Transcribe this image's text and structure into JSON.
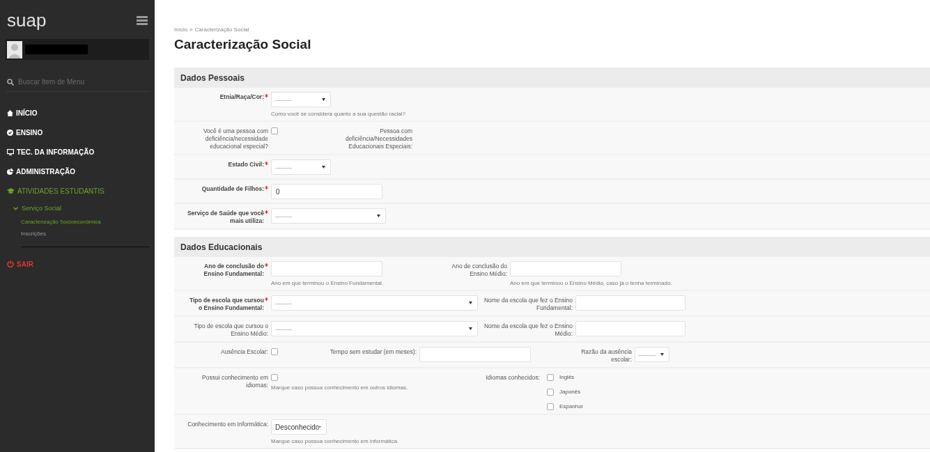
{
  "sidebar": {
    "logo": "suap",
    "search": {
      "placeholder": "Buscar Item de Menu"
    },
    "menu": [
      {
        "label": "INÍCIO",
        "selected": false
      },
      {
        "label": "ENSINO",
        "selected": false
      },
      {
        "label": "TEC. DA INFORMAÇÃO",
        "selected": false
      },
      {
        "label": "ADMINISTRAÇÃO",
        "selected": false
      },
      {
        "label": "ATIVIDADES ESTUDANTIS",
        "selected": true,
        "children": [
          {
            "label": "Serviço Social",
            "selected": true,
            "expanded": true,
            "children": [
              {
                "label": "Caracterização Socioeconômica",
                "selected": true
              },
              {
                "label": "Inscrições",
                "selected": false
              }
            ]
          }
        ]
      }
    ],
    "logout": {
      "label": "SAIR"
    }
  },
  "breadcrumb": {
    "items": [
      "Início",
      "Caracterização Social"
    ],
    "separator": "»"
  },
  "title": "Caracterização Social",
  "sections": [
    {
      "title": "Dados Pessoais",
      "rows": [
        {
          "fields": [
            {
              "kind": "select",
              "label": "Etnia/Raça/Cor:",
              "required": true,
              "value": "---------",
              "help": "Como você se considera quanto a sua questão racial?"
            }
          ]
        },
        {
          "fields": [
            {
              "kind": "checkbox",
              "label": "Você é uma pessoa com deficiência/necessidade educacional especial?",
              "required": false,
              "checked": false
            },
            {
              "kind": "label",
              "label": "Pessoa com deficiência/Necessidades Educacionais Especiais:",
              "required": false
            }
          ]
        },
        {
          "fields": [
            {
              "kind": "select",
              "label": "Estado Civil:",
              "required": true,
              "value": "---------"
            }
          ]
        },
        {
          "fields": [
            {
              "kind": "text",
              "label": "Quantidade de Filhos:",
              "required": true,
              "value": "0"
            }
          ]
        },
        {
          "fields": [
            {
              "kind": "select",
              "label": "Serviço de Saúde que você mais utiliza:",
              "required": true,
              "value": "---------"
            }
          ]
        }
      ]
    },
    {
      "title": "Dados Educacionais",
      "rows": [
        {
          "fields": [
            {
              "kind": "text",
              "label": "Ano de conclusão do Ensino Fundamental:",
              "required": true,
              "help": "Ano em que terminou o Ensino Fundamental."
            },
            {
              "kind": "text",
              "label": "Ano de conclusão do Ensino Médio:",
              "required": false,
              "help": "Ano em que terminou o Ensino Médio, caso já o tenha terminado."
            }
          ]
        },
        {
          "fields": [
            {
              "kind": "select",
              "label": "Tipo de escola que cursou o Ensino Fundamental:",
              "required": true,
              "value": "---------"
            },
            {
              "kind": "text",
              "label": "Nome da escola que fez o Ensino Fundamental:",
              "required": false
            }
          ]
        },
        {
          "fields": [
            {
              "kind": "select",
              "label": "Tipo de escola que cursou o Ensino Médio:",
              "required": false,
              "value": "---------"
            },
            {
              "kind": "text",
              "label": "Nome da escola que fez o Ensino Médio:",
              "required": false
            }
          ]
        },
        {
          "fields": [
            {
              "kind": "checkbox",
              "label": "Ausência Escolar:",
              "required": false,
              "checked": false
            },
            {
              "kind": "text",
              "label": "Tempo sem estudar (em meses):",
              "required": false
            },
            {
              "kind": "select",
              "label": "Razão da ausência escolar:",
              "required": false,
              "value": "---------"
            }
          ]
        },
        {
          "fields": [
            {
              "kind": "checkbox",
              "label": "Possui conhecimento em idiomas:",
              "required": false,
              "checked": false,
              "help": "Marque caso possua conhecimento em outros idiomas."
            },
            {
              "kind": "checklist",
              "label": "Idiomas conhecidos:",
              "required": false,
              "options": [
                {
                  "label": "Inglês",
                  "checked": false
                },
                {
                  "label": "Japonês",
                  "checked": false
                },
                {
                  "label": "Espanhol",
                  "checked": false
                }
              ]
            }
          ]
        },
        {
          "fields": [
            {
              "kind": "select",
              "label": "Conhecimento em Informática:",
              "required": false,
              "value": "Desconhecido",
              "help": "Marque caso possua conhecimento em informática."
            }
          ]
        }
      ]
    }
  ]
}
